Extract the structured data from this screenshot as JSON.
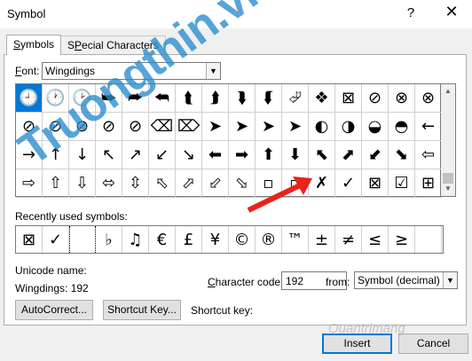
{
  "window": {
    "title": "Symbol",
    "help": "?",
    "close": "✕"
  },
  "tabs": [
    {
      "label_u": "S",
      "label_rest": "ymbols",
      "active": true
    },
    {
      "label_u": "P",
      "label_rest": "ecial Characters",
      "prefix": "S",
      "active": false
    }
  ],
  "font": {
    "label_u": "F",
    "label_rest": "ont:",
    "value": "Wingdings"
  },
  "symbols": [
    [
      "🕘",
      "🕐",
      "🕑",
      "⮩",
      "⮫",
      "⮪",
      "⮬",
      "⮭",
      "⮯",
      "⮮",
      "⮰",
      "❖",
      "⊠",
      "⊘",
      "⊗",
      "⊗"
    ],
    [
      "⊘",
      "⊘",
      "⊘",
      "⊘",
      "⊘",
      "⌫",
      "⌦",
      "➤",
      "➤",
      "➤",
      "➤",
      "◐",
      "◑",
      "◒",
      "◓",
      "←"
    ],
    [
      "→",
      "↑",
      "↓",
      "↖",
      "↗",
      "↙",
      "↘",
      "⬅",
      "➡",
      "⬆",
      "⬇",
      "⬉",
      "⬈",
      "⬋",
      "⬊",
      "⇦"
    ],
    [
      "⇨",
      "⇧",
      "⇩",
      "⬄",
      "⇳",
      "⬁",
      "⬀",
      "⬃",
      "⬂",
      "▫",
      "▫",
      "✗",
      "✓",
      "⊠",
      "☑",
      "⊞"
    ]
  ],
  "recent": {
    "label": "Recently used symbols:",
    "items": [
      "⊠",
      "✓",
      "",
      "♭",
      "♫",
      "€",
      "£",
      "¥",
      "©",
      "®",
      "™",
      "±",
      "≠",
      "≤",
      "≥",
      ""
    ]
  },
  "unicode": {
    "name_label": "Unicode name:",
    "code_text": "Wingdings: 192"
  },
  "charcode": {
    "label_pre": "",
    "label_u": "C",
    "label_rest": "haracter code:",
    "value": "192"
  },
  "from": {
    "label": "from:",
    "value": "Symbol (decimal)"
  },
  "buttons": {
    "autocorrect": "AutoCorrect...",
    "shortcut_key": "Shortcut Key...",
    "insert": "Insert",
    "cancel": "Cancel"
  },
  "shortcut_label": "Shortcut key:",
  "watermarks": {
    "primary": "Truongthin.vn",
    "secondary": "Quantrimang"
  }
}
